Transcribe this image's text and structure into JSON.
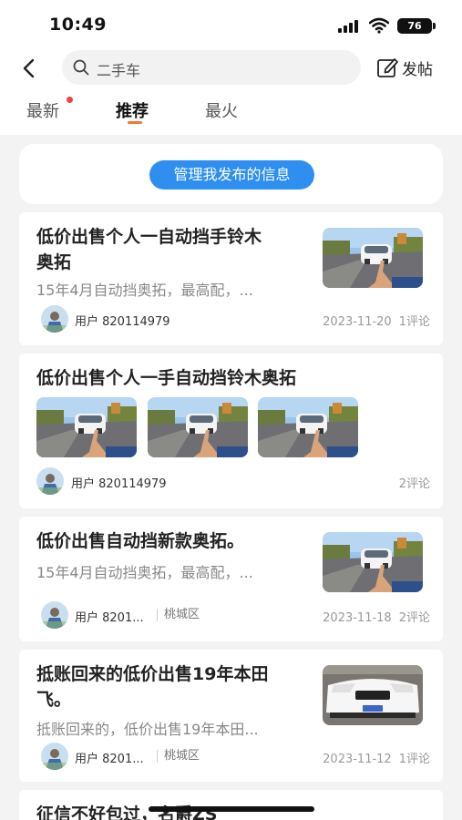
{
  "status_bar": {
    "time": "10:49",
    "battery": "76"
  },
  "nav": {
    "search_text": "二手车",
    "post_label": "发帖"
  },
  "tabs": [
    {
      "label": "最新",
      "has_dot": true
    },
    {
      "label": "推荐",
      "active": true
    },
    {
      "label": "最火"
    }
  ],
  "manage_button": "管理我发布的信息",
  "posts": [
    {
      "title_line1": "低价出售个人一自动挡手铃木",
      "title_line2": "奥拓",
      "desc": "15年4月自动挡奥拓，最高配，...",
      "user": "用户 820114979",
      "date": "2023-11-20",
      "comments": "1评论"
    },
    {
      "title_line1": "低价出售个人一手自动挡铃木奥拓",
      "user": "用户 820114979",
      "comments": "2评论"
    },
    {
      "title_line1": "低价出售自动挡新款奥拓。",
      "desc": "15年4月自动挡奥拓，最高配，...",
      "user": "用户 8201...",
      "location": "桃城区",
      "date": "2023-11-18",
      "comments": "2评论"
    },
    {
      "title_line1": "抵账回来的低价出售19年本田",
      "title_line2": "飞。",
      "desc": "抵账回来的，低价出售19年本田...",
      "user": "用户 8201...",
      "location": "桃城区",
      "date": "2023-11-12",
      "comments": "1评论"
    },
    {
      "title_line1": "征信不好包过，名爵ZS"
    }
  ],
  "colors": {
    "accent_blue": "#2e8ff0",
    "tab_underline": "#f07a2a",
    "dot_red": "#f0404a"
  }
}
